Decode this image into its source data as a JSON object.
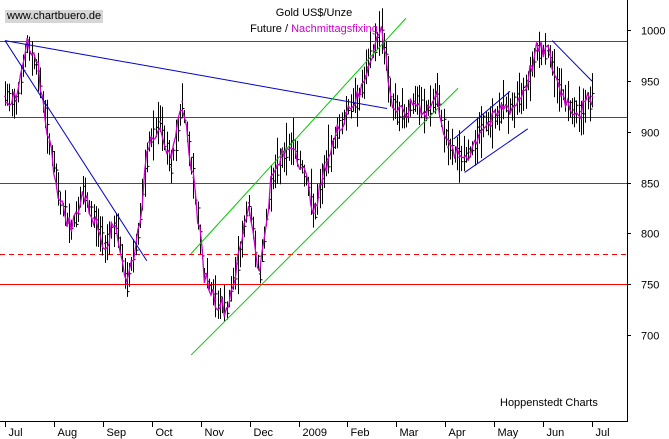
{
  "site_label": "www.chartbuero.de",
  "footer": "Hoppenstedt Charts",
  "title_line1": "Gold US$/Unze",
  "title_future": "Future",
  "title_sep": " / ",
  "title_fixing": "Nachmittagsfixing",
  "colors": {
    "candles": "#000000",
    "fixing": "#cc00cc",
    "resistance": "#ff0000",
    "trend_blue": "#0000cc",
    "channel_green": "#00cc00"
  },
  "chart_data": {
    "type": "line",
    "title": "Gold US$/Unze",
    "subtitle": "Future / Nachmittagsfixing",
    "ylim": [
      615,
      1030
    ],
    "y_ticks": [
      700,
      750,
      800,
      850,
      900,
      950,
      1000
    ],
    "y_axis_side": "right",
    "x_ticks": [
      "Jul",
      "Aug",
      "Sep",
      "Oct",
      "Nov",
      "Dec",
      "2009",
      "Feb",
      "Mar",
      "Apr",
      "May",
      "Jun",
      "Jul"
    ],
    "grid": false,
    "horizontal_lines": [
      {
        "value": 990,
        "style": "solid",
        "color": "#ff0000"
      },
      {
        "value": 915,
        "style": "solid",
        "color": "#ff0000"
      },
      {
        "value": 850,
        "style": "solid",
        "color": "#ff0000"
      },
      {
        "value": 780,
        "style": "dashed",
        "color": "#ff0000"
      },
      {
        "value": 750,
        "style": "solid",
        "color": "#ff0000"
      }
    ],
    "trend_lines": [
      {
        "color": "#0000cc",
        "points": [
          [
            0,
            990
          ],
          [
            12.8,
            773
          ]
        ]
      },
      {
        "color": "#0000cc",
        "points": [
          [
            0,
            990
          ],
          [
            34.5,
            923
          ]
        ]
      },
      {
        "color": "#0000cc",
        "points": [
          [
            40.5,
            893
          ],
          [
            45.6,
            940
          ]
        ]
      },
      {
        "color": "#0000cc",
        "points": [
          [
            41.5,
            860
          ],
          [
            47.2,
            903
          ]
        ]
      },
      {
        "color": "#0000cc",
        "points": [
          [
            49.4,
            990
          ],
          [
            53,
            950
          ]
        ]
      },
      {
        "color": "#00cc00",
        "points": [
          [
            16.8,
            780
          ],
          [
            36.2,
            1012
          ]
        ]
      },
      {
        "color": "#00cc00",
        "points": [
          [
            16.8,
            680
          ],
          [
            40.9,
            943
          ]
        ]
      }
    ],
    "series": [
      {
        "name": "Nachmittagsfixing",
        "x": [
          0,
          1,
          2,
          3,
          4,
          5,
          6,
          7,
          8,
          9,
          10,
          11,
          12,
          13,
          14,
          15,
          16,
          17,
          18,
          19,
          20,
          21,
          22,
          23,
          24,
          25,
          26,
          27,
          28,
          29,
          30,
          31,
          32,
          33,
          34,
          35,
          36,
          37,
          38,
          39,
          40,
          41,
          42,
          43,
          44,
          45,
          46,
          47,
          48,
          49,
          50,
          51,
          52,
          53
        ],
        "values": [
          935,
          930,
          985,
          960,
          890,
          830,
          805,
          840,
          815,
          790,
          810,
          750,
          800,
          890,
          910,
          865,
          930,
          855,
          760,
          735,
          725,
          770,
          830,
          760,
          850,
          875,
          890,
          860,
          820,
          870,
          900,
          925,
          935,
          975,
          1002,
          925,
          915,
          930,
          920,
          935,
          885,
          875,
          880,
          905,
          910,
          925,
          925,
          945,
          980,
          980,
          945,
          925,
          920,
          935
        ]
      }
    ]
  }
}
